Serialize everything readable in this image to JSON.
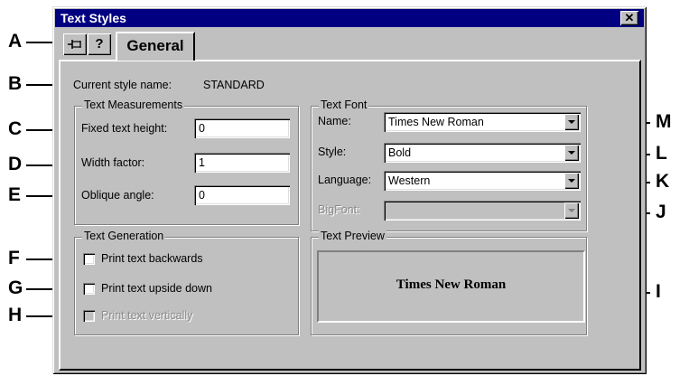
{
  "window": {
    "title": "Text Styles",
    "close_glyph": "✕"
  },
  "toolbar": {
    "pin_icon": "pin-icon",
    "help_icon": "help-icon",
    "pin_glyph": "⊣",
    "help_glyph": "?"
  },
  "tabs": [
    {
      "label": "General"
    }
  ],
  "current_style": {
    "label": "Current style name:",
    "value": "STANDARD"
  },
  "text_measurements": {
    "legend": "Text Measurements",
    "fixed_height": {
      "label": "Fixed text height:",
      "value": "0"
    },
    "width_factor": {
      "label": "Width factor:",
      "value": "1"
    },
    "oblique_angle": {
      "label": "Oblique angle:",
      "value": "0"
    }
  },
  "text_font": {
    "legend": "Text Font",
    "name": {
      "label": "Name:",
      "value": "Times New Roman"
    },
    "style": {
      "label": "Style:",
      "value": "Bold"
    },
    "language": {
      "label": "Language:",
      "value": "Western"
    },
    "bigfont": {
      "label": "BigFont:",
      "value": ""
    }
  },
  "text_generation": {
    "legend": "Text Generation",
    "backwards": {
      "label": "Print text backwards",
      "checked": false
    },
    "upside_down": {
      "label": "Print text upside down",
      "checked": false
    },
    "vertically": {
      "label": "Print text vertically",
      "checked": false,
      "disabled": true
    }
  },
  "text_preview": {
    "legend": "Text Preview",
    "sample": "Times New Roman"
  },
  "callouts": {
    "A": "A",
    "B": "B",
    "C": "C",
    "D": "D",
    "E": "E",
    "F": "F",
    "G": "G",
    "H": "H",
    "I": "I",
    "J": "J",
    "K": "K",
    "L": "L",
    "M": "M"
  },
  "colors": {
    "title_bar": "#000080",
    "face": "#c0c0c0"
  }
}
